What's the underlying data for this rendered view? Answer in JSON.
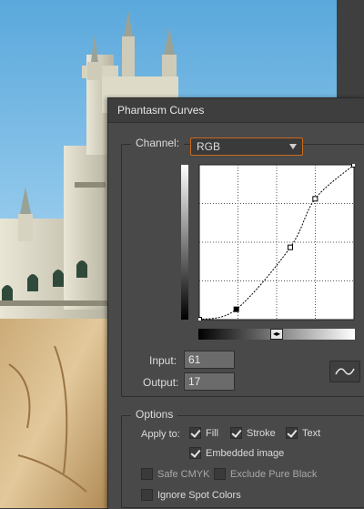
{
  "dialog": {
    "title": "Phantasm Curves"
  },
  "channel": {
    "label": "Channel:",
    "value": "RGB"
  },
  "curve": {
    "points": [
      [
        0,
        0
      ],
      [
        61,
        17
      ],
      [
        150,
        119
      ],
      [
        191,
        199
      ],
      [
        255,
        255
      ]
    ],
    "selected_point": [
      61,
      17
    ]
  },
  "input": {
    "label": "Input:",
    "value": "61"
  },
  "output": {
    "label": "Output:",
    "value": "17"
  },
  "options": {
    "title": "Options",
    "apply_to_label": "Apply to:",
    "fill": {
      "label": "Fill",
      "checked": true
    },
    "stroke": {
      "label": "Stroke",
      "checked": true
    },
    "text": {
      "label": "Text",
      "checked": true
    },
    "embedded_image": {
      "label": "Embedded image",
      "checked": true
    },
    "safe_cmyk": {
      "label": "Safe CMYK",
      "checked": false
    },
    "exclude_pure_black": {
      "label": "Exclude Pure Black",
      "checked": false
    },
    "ignore_spot_colors": {
      "label": "Ignore Spot Colors",
      "checked": false
    }
  }
}
